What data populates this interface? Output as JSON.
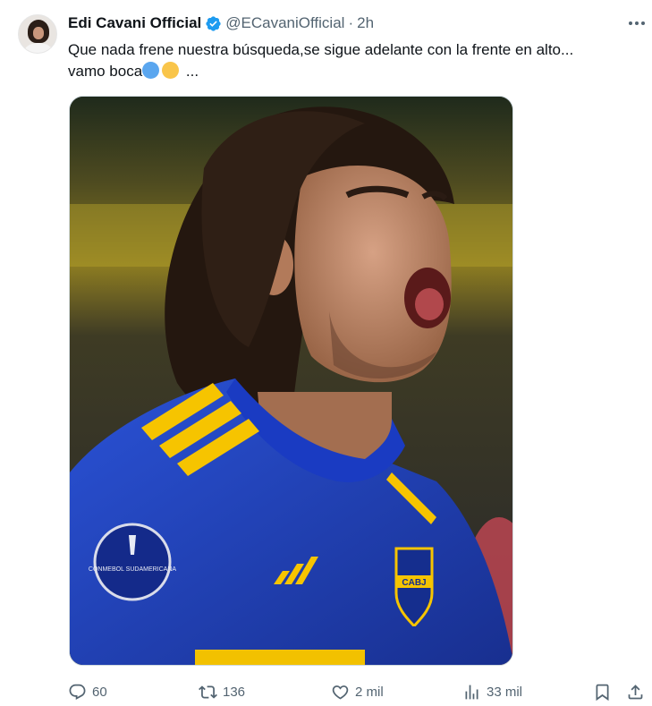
{
  "tweet": {
    "display_name": "Edi Cavani Official",
    "handle": "@ECavaniOfficial",
    "separator": "·",
    "time": "2h",
    "text_line1": "Que nada frene nuestra búsqueda,se sigue adelante con la frente en alto...",
    "text_line2_prefix": "vamo boca",
    "text_line2_suffix": "...",
    "emojis": [
      "blue-circle",
      "yellow-circle"
    ],
    "image_jersey_text": "CONMEBOL SUDAMERICANA",
    "crest_text": "CABJ"
  },
  "actions": {
    "reply_count": "60",
    "repost_count": "136",
    "like_count": "2 mil",
    "views_count": "33 mil"
  },
  "colors": {
    "text": "#0f1419",
    "muted": "#536471",
    "verified": "#1d9bf0",
    "jersey_blue": "#1f3fae",
    "stripe_yellow": "#f6c400"
  }
}
